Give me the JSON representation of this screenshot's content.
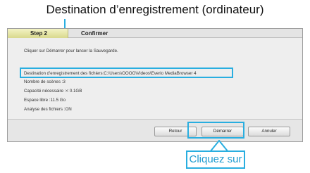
{
  "annotation": {
    "caption": "Destination d’enregistrement (ordinateur)",
    "callout": "Cliquez sur",
    "highlight_color": "#29aee0"
  },
  "wizard": {
    "tabs": {
      "step": "Step 2",
      "current": "Confirmer"
    },
    "intro": "Cliquer sur Démarrer pour lancer la Sauvegarde.",
    "destination": "Destination d'enregistrement des fichiers:C:\\Users\\OOOO\\Videos\\Everio MediaBrowser 4",
    "scenes": "Nombre de scènes :3",
    "capacity": "Capacité nécessaire :< 0.1GB",
    "free_space": "Espace libre :11.5 Go",
    "analysis": "Analyse des fichiers :ON"
  },
  "buttons": {
    "back": "Retour",
    "start": "Démarrer",
    "cancel": "Annuler"
  }
}
